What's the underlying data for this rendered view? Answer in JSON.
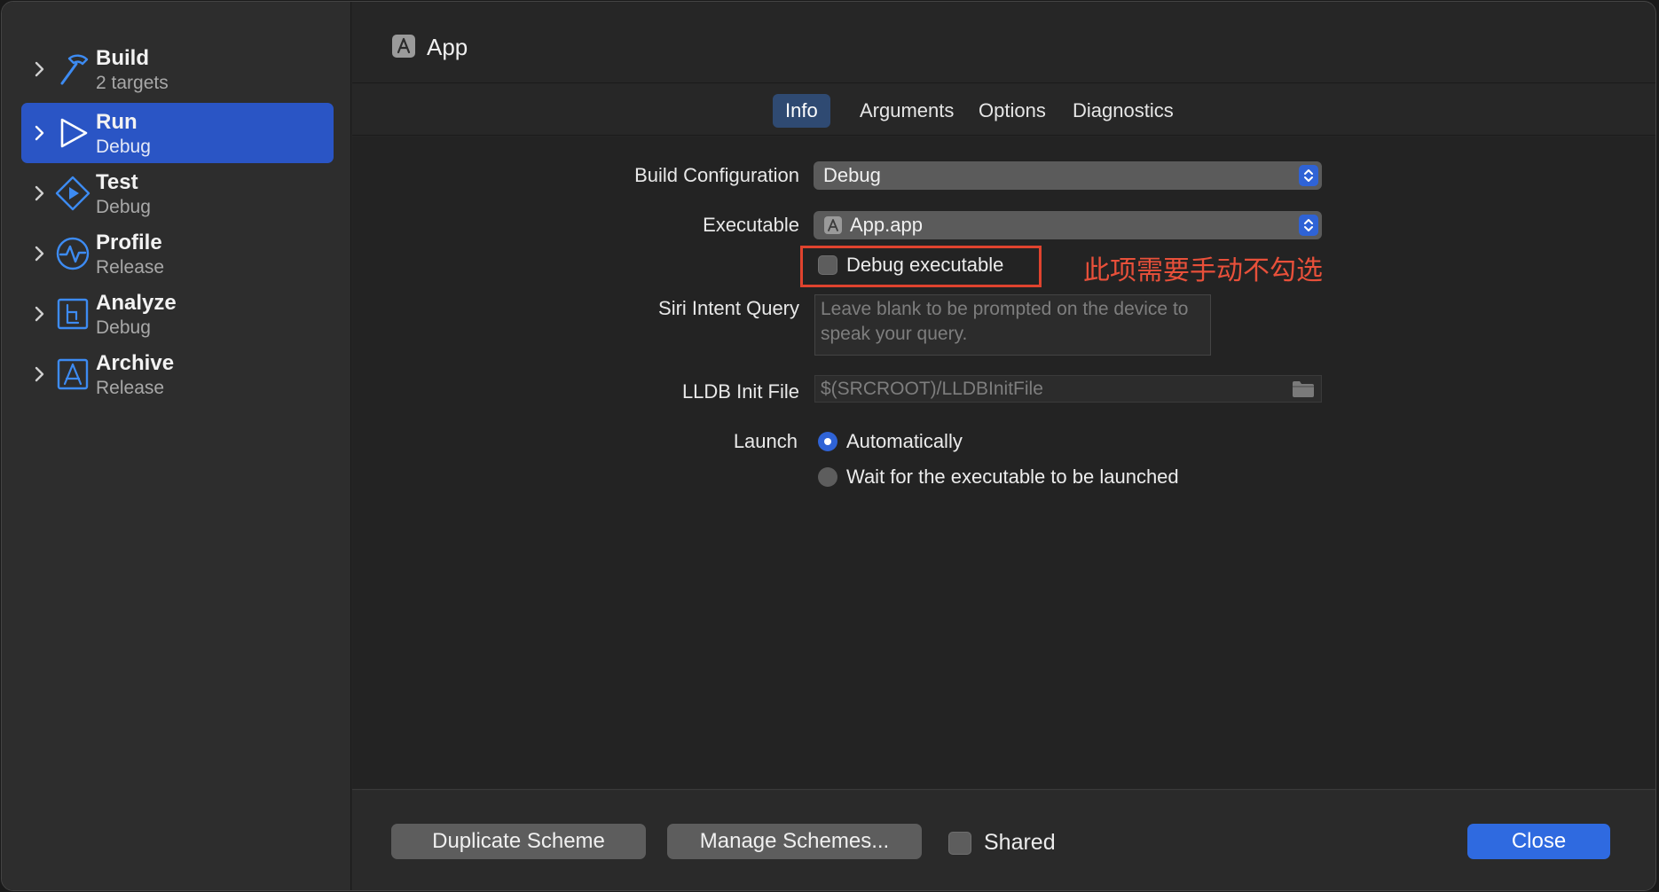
{
  "colors": {
    "accent": "#2f63d6",
    "sidebar_selected": "#2a55c5",
    "annotation": "#e8503a"
  },
  "sidebar": {
    "items": [
      {
        "title": "Build",
        "subtitle": "2 targets",
        "icon": "hammer-icon",
        "selected": false
      },
      {
        "title": "Run",
        "subtitle": "Debug",
        "icon": "play-icon",
        "selected": true
      },
      {
        "title": "Test",
        "subtitle": "Debug",
        "icon": "diamond-play-icon",
        "selected": false
      },
      {
        "title": "Profile",
        "subtitle": "Release",
        "icon": "pulse-icon",
        "selected": false
      },
      {
        "title": "Analyze",
        "subtitle": "Debug",
        "icon": "analyze-icon",
        "selected": false
      },
      {
        "title": "Archive",
        "subtitle": "Release",
        "icon": "archive-icon",
        "selected": false
      }
    ]
  },
  "header": {
    "title": "App",
    "icon": "app-icon"
  },
  "tabs": [
    {
      "label": "Info",
      "active": true
    },
    {
      "label": "Arguments",
      "active": false
    },
    {
      "label": "Options",
      "active": false
    },
    {
      "label": "Diagnostics",
      "active": false
    }
  ],
  "form": {
    "build_configuration": {
      "label": "Build Configuration",
      "value": "Debug"
    },
    "executable": {
      "label": "Executable",
      "value": "App.app"
    },
    "debug_executable": {
      "label": "Debug executable",
      "checked": false
    },
    "annotation": "此项需要手动不勾选",
    "siri_intent_query": {
      "label": "Siri Intent Query",
      "placeholder": "Leave blank to be prompted on the device to speak your query."
    },
    "lldb_init_file": {
      "label": "LLDB Init File",
      "placeholder": "$(SRCROOT)/LLDBInitFile"
    },
    "launch": {
      "label": "Launch",
      "options": [
        {
          "label": "Automatically",
          "selected": true
        },
        {
          "label": "Wait for the executable to be launched",
          "selected": false
        }
      ]
    }
  },
  "footer": {
    "duplicate_label": "Duplicate Scheme",
    "manage_label": "Manage Schemes...",
    "shared_label": "Shared",
    "shared_checked": false,
    "close_label": "Close"
  }
}
